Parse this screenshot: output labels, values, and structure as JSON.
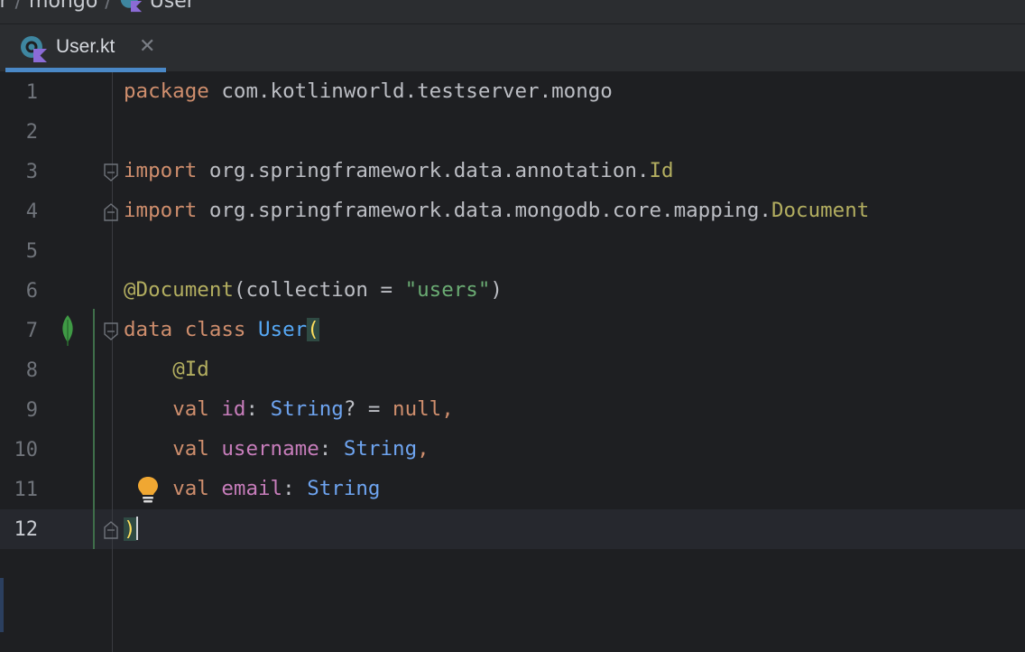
{
  "breadcrumb": {
    "items": [
      "er",
      "mongo",
      "User"
    ],
    "separator": "/"
  },
  "tab": {
    "label": "User.kt",
    "close_glyph": "✕",
    "icon": "kotlin-class-icon"
  },
  "editor": {
    "current_line": 12,
    "lines": [
      {
        "n": "1",
        "tokens": [
          [
            "kw",
            "package"
          ],
          [
            "plain",
            " com.kotlinworld.testserver.mongo"
          ]
        ]
      },
      {
        "n": "2",
        "tokens": []
      },
      {
        "n": "3",
        "tokens": [
          [
            "kw",
            "import"
          ],
          [
            "plain",
            " org.springframework.data.annotation."
          ],
          [
            "ann",
            "Id"
          ]
        ]
      },
      {
        "n": "4",
        "tokens": [
          [
            "kw",
            "import"
          ],
          [
            "plain",
            " org.springframework.data.mongodb.core.mapping."
          ],
          [
            "ann",
            "Document"
          ]
        ]
      },
      {
        "n": "5",
        "tokens": []
      },
      {
        "n": "6",
        "tokens": [
          [
            "ann",
            "@Document"
          ],
          [
            "plain",
            "(collection = "
          ],
          [
            "str",
            "\"users\""
          ],
          [
            "plain",
            ")"
          ]
        ]
      },
      {
        "n": "7",
        "tokens": [
          [
            "kw",
            "data class "
          ],
          [
            "cls",
            "User"
          ],
          [
            "brace-hl",
            "("
          ]
        ]
      },
      {
        "n": "8",
        "tokens": [
          [
            "plain",
            "    "
          ],
          [
            "ann",
            "@Id"
          ]
        ]
      },
      {
        "n": "9",
        "tokens": [
          [
            "plain",
            "    "
          ],
          [
            "kw",
            "val "
          ],
          [
            "prop",
            "id"
          ],
          [
            "plain",
            ": "
          ],
          [
            "typ",
            "String"
          ],
          [
            "plain",
            "? = "
          ],
          [
            "kw",
            "null"
          ],
          [
            "kw",
            ","
          ]
        ]
      },
      {
        "n": "10",
        "tokens": [
          [
            "plain",
            "    "
          ],
          [
            "kw",
            "val "
          ],
          [
            "prop",
            "username"
          ],
          [
            "plain",
            ": "
          ],
          [
            "typ",
            "String"
          ],
          [
            "kw",
            ","
          ]
        ]
      },
      {
        "n": "11",
        "tokens": [
          [
            "plain",
            "    "
          ],
          [
            "kw",
            "val "
          ],
          [
            "prop",
            "email"
          ],
          [
            "plain",
            ": "
          ],
          [
            "typ",
            "String"
          ]
        ]
      },
      {
        "n": "12",
        "tokens": [
          [
            "brace-hl",
            ")"
          ]
        ]
      }
    ]
  },
  "colors": {
    "background": "#1e1f22",
    "keyword": "#cf8e6d",
    "annotation": "#b3ae60",
    "string": "#6aab73",
    "class": "#56a8f5",
    "property": "#c77dbb",
    "tab_underline": "#4a88c7"
  }
}
